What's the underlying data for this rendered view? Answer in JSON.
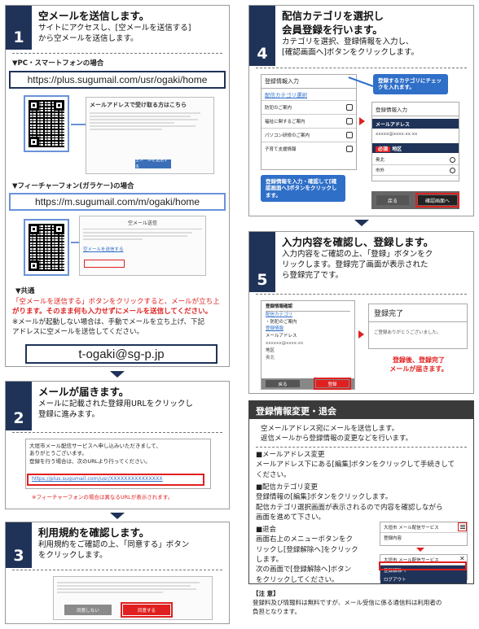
{
  "s1": {
    "num": "1",
    "title": "空メールを送信します。",
    "sub1": "サイトにアクセスし、[空メールを送信する]",
    "sub2": "から空メールを送信します。",
    "pc_label": "▼PC・スマートフォンの場合",
    "pc_url": "https://plus.sugumail.com/usr/ogaki/home",
    "pc_shot_title": "メールアドレスで受け取る方はこちら",
    "pc_shot_btn": "空メールを送信する",
    "fp_label": "▼フィーチャーフォン(ガラケー)の場合",
    "fp_url": "https://m.sugumail.com/m/ogaki/home",
    "fp_shot_title": "空メール送信",
    "fp_shot_link": "空メールを送信する",
    "common_label": "▼共通",
    "note1": "「空メールを送信する」ボタンをクリックすると、メールが立ち上",
    "note2": "がります。そのまま何も入力せずにメールを送信してください。",
    "note3": "※メールが起動しない場合は、手動でメールを立ち上げ、下記",
    "note4": "アドレスに空メールを送信してください。",
    "email": "t-ogaki@sg-p.jp"
  },
  "s2": {
    "num": "2",
    "title": "メールが届きます。",
    "sub1": "メールに記載された登録用URLをクリックし",
    "sub2": "登録に進みます。",
    "mail1": "大垣市メール配信サービスへ申し込みいただきまして、",
    "mail2": "ありがとうございます。",
    "mail3": "登録を行う場合は、次のURLより行ってください。",
    "mail_url": "https://plus.sugumail.com/usr/XXXXXXXXXXXXXXX",
    "note": "※フィーチャーフォンの場合は異なるURLが表示されます。"
  },
  "s3": {
    "num": "3",
    "title": "利用規約を確認します。",
    "sub1": "利用規約をご確認の上、「同意する」ボタン",
    "sub2": "をクリックします。",
    "btn_no": "同意しない",
    "btn_yes": "同意する"
  },
  "s4": {
    "num": "4",
    "title1": "配信カテゴリを選択し",
    "title2": "会員登録を行います。",
    "sub1": "カテゴリを選択、登録情報を入力し、",
    "sub2": "[確認画面へ]ボタンをクリックします。",
    "form_title": "登録情報入力",
    "cat_label": "配信カテゴリ選択",
    "cats": [
      "防犯のご案内",
      "福祉に関するご案内",
      "パソコン研修のご案内",
      "子育て支援情報"
    ],
    "callout1": "登録するカテゴリにチェックを入れます。",
    "reg_title": "登録情報入力",
    "mail_label": "メールアドレス",
    "mail_val": "xxxxx@xxxx.xx.xx",
    "required": "必須",
    "area": "地区",
    "areas": [
      "奥北",
      "市外"
    ],
    "callout2": "登録情報を入力・確認して[確認画面へ]ボタンをクリックします。",
    "btn_back": "戻る",
    "btn_confirm": "確認画面へ"
  },
  "s5": {
    "num": "5",
    "title": "入力内容を確認し、登録します。",
    "sub1": "入力内容をご確認の上、「登録」ボタンをク",
    "sub2": "リックします。登録完了画面が表示された",
    "sub3": "ら登録完了です。",
    "conf_title": "登録情報確認",
    "conf_cat": "配信カテゴリ",
    "conf_cat_val": "・防犯のご案内",
    "conf_reg": "登録情報",
    "conf_mail": "メールアドレス",
    "conf_mail_val": "xxxxxx@xxxx.xx",
    "conf_area": "地区",
    "conf_area_val": "奥北",
    "btn_back": "戻る",
    "btn_reg": "登録",
    "done_title": "登録完了",
    "done_msg": "ご登録ありがとうございました。",
    "red1": "登録後、登録完了",
    "red2": "メールが届きます。"
  },
  "change": {
    "title": "登録情報変更・退会",
    "intro1": "空メールアドレス宛にメールを送信します。",
    "intro2": "返信メールから登録情報の変更などを行います。",
    "h1": "■メールアドレス変更",
    "t1a": "メールアドレス下にある[編集]ボタンをクリックして手続きして",
    "t1b": "ください。",
    "h2": "■配信カテゴリ変更",
    "t2a": "登録情報の[編集]ボタンをクリックします。",
    "t2b": "配信カテゴリ選択画面が表示されるので内容を確認しながら",
    "t2c": "画面を進めて下さい。",
    "h3": "■退会",
    "t3a": "画面右上のメニューボタンをク",
    "t3b": "リックし[登録解除へ]をクリック",
    "t3c": "します。",
    "t3d": "次の画面で[登録解除へ]ボタン",
    "t3e": "をクリックしてください。",
    "m1": "大垣市 メール配信サービス",
    "m2": "登録内容",
    "m3": "大垣市 メール配信サービス",
    "m4": "登録解除へ",
    "m5": "ログアウト",
    "note_h": "【注 意】",
    "note1": "登録料及び情報料は無料ですが、メール受信に係る通信料は利用者の",
    "note2": "負担となります。"
  },
  "colors": {
    "navy": "#1f3258",
    "red": "#e02020",
    "blue": "#2f6fc8"
  }
}
